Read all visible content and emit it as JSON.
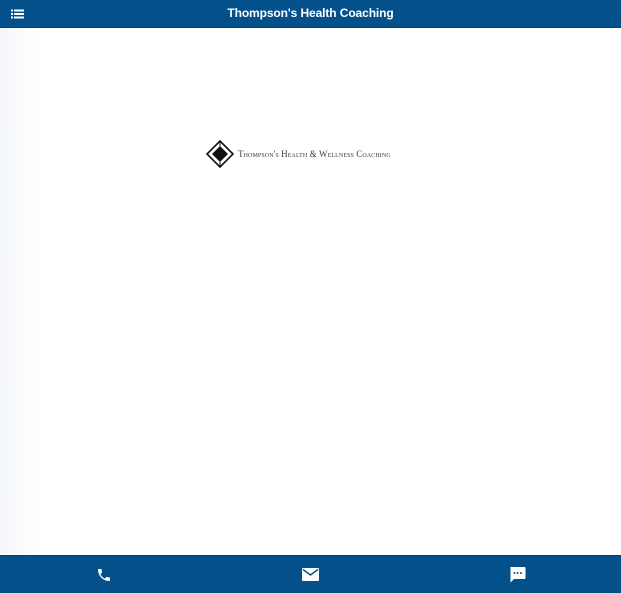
{
  "header": {
    "title": "Thompson's Health Coaching",
    "menu_icon": "menu-list-icon"
  },
  "logo": {
    "text": "Thompson's Health & Wellness Coaching",
    "mark_icon": "diamond-logo-icon"
  },
  "bottom_bar": {
    "actions": [
      {
        "name": "call",
        "icon": "phone-icon"
      },
      {
        "name": "email",
        "icon": "mail-icon"
      },
      {
        "name": "message",
        "icon": "chat-bubble-icon"
      }
    ]
  },
  "colors": {
    "bar_background": "#03508a",
    "bar_text": "#ffffff",
    "page_background": "#ffffff"
  }
}
